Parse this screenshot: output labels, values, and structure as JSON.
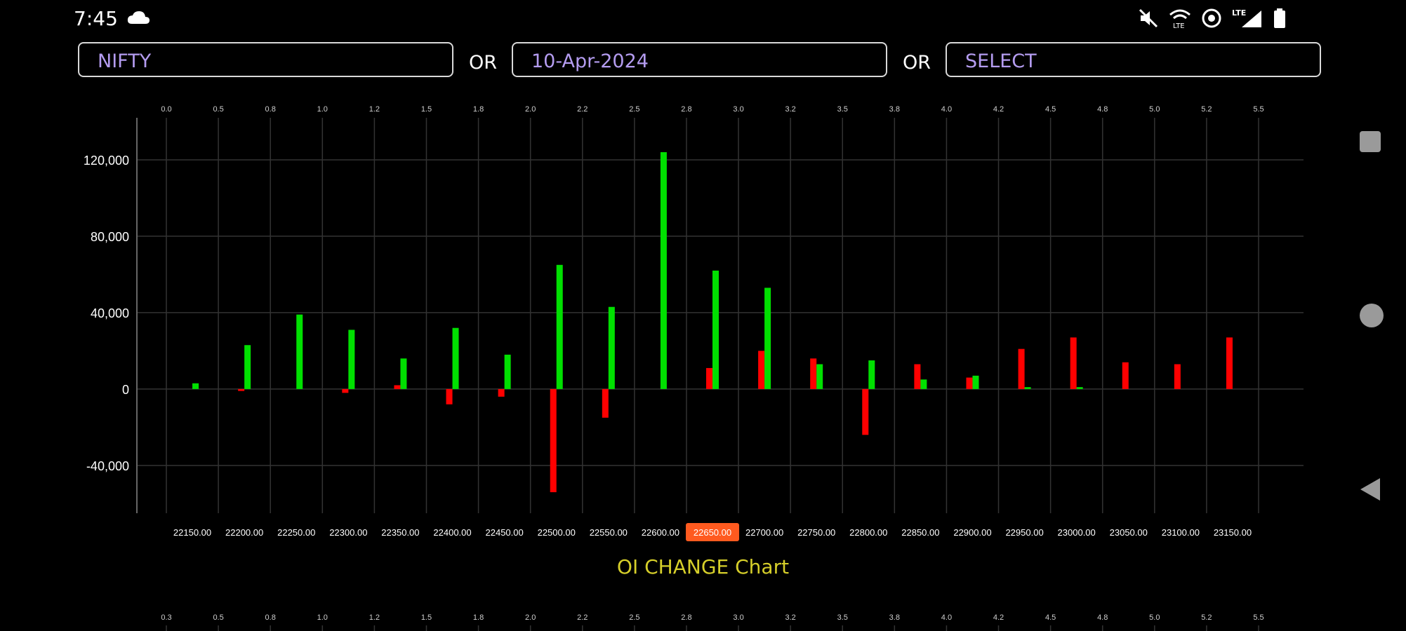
{
  "status": {
    "time": "7:45",
    "network": "LTE"
  },
  "selectors": {
    "symbol": "NIFTY",
    "date": "10-Apr-2024",
    "expiry": "SELECT",
    "or_label": "OR"
  },
  "colors": {
    "call": "#00e000",
    "put": "#ff0000",
    "grid": "#333333",
    "highlight": "#ff5a1f",
    "title": "#d6cf2a",
    "selector_text": "#b49cf0"
  },
  "chart_data": {
    "type": "bar",
    "title": "OI CHANGE Chart",
    "categories": [
      "22150.00",
      "22200.00",
      "22250.00",
      "22300.00",
      "22350.00",
      "22400.00",
      "22450.00",
      "22500.00",
      "22550.00",
      "22600.00",
      "22650.00",
      "22700.00",
      "22750.00",
      "22800.00",
      "22850.00",
      "22900.00",
      "22950.00",
      "23000.00",
      "23050.00",
      "23100.00",
      "23150.00"
    ],
    "highlighted_category": "22650.00",
    "top_axis_labels": [
      "0.0",
      "0.5",
      "0.8",
      "1.0",
      "1.2",
      "1.5",
      "1.8",
      "2.0",
      "2.2",
      "2.5",
      "2.8",
      "3.0",
      "3.2",
      "3.5",
      "3.8",
      "4.0",
      "4.2",
      "4.5",
      "4.8",
      "5.0",
      "5.2",
      "5.5"
    ],
    "bottom_axis_labels": [
      "0.3",
      "0.5",
      "0.8",
      "1.0",
      "1.2",
      "1.5",
      "1.8",
      "2.0",
      "2.2",
      "2.5",
      "2.8",
      "3.0",
      "3.2",
      "3.5",
      "3.8",
      "4.0",
      "4.2",
      "4.5",
      "4.8",
      "5.0",
      "5.2",
      "5.5"
    ],
    "yticks": [
      -40000,
      0,
      40000,
      80000,
      120000
    ],
    "ytick_labels": [
      "-40,000",
      "0",
      "40,000",
      "80,000",
      "120,000"
    ],
    "ylim": [
      -65000,
      142000
    ],
    "grid": true,
    "series": [
      {
        "color": "#ff0000",
        "values": [
          0,
          -1000,
          0,
          -2000,
          2000,
          -8000,
          -4000,
          -54000,
          -15000,
          0,
          11000,
          20000,
          16000,
          -24000,
          13000,
          6000,
          21000,
          27000,
          14000,
          13000,
          27000
        ]
      },
      {
        "color": "#00e000",
        "values": [
          3000,
          23000,
          39000,
          31000,
          16000,
          32000,
          18000,
          65000,
          43000,
          124000,
          62000,
          53000,
          13000,
          15000,
          5000,
          7000,
          1000,
          1000,
          0,
          0,
          0
        ]
      }
    ]
  }
}
